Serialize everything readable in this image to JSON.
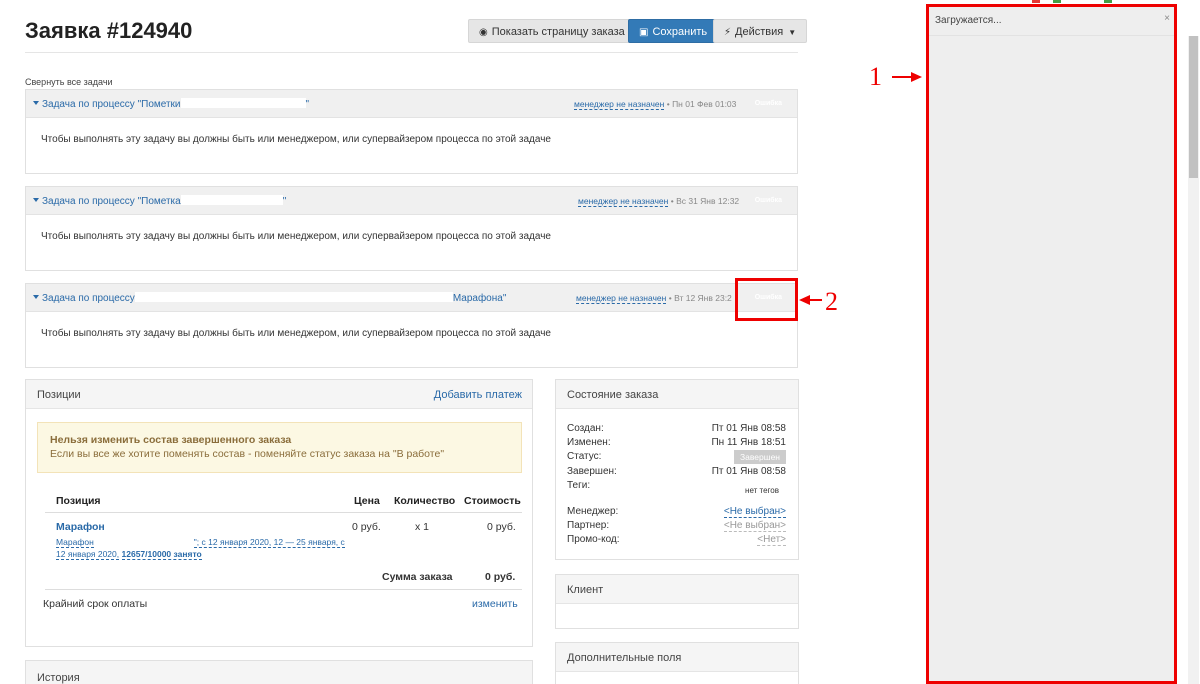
{
  "order": {
    "title": "Заявка #124940",
    "buttons": {
      "show_page": "Показать страницу заказа",
      "save": "Сохранить",
      "actions": "Действия"
    },
    "collapse_all": "Свернуть все задачи"
  },
  "tasks": [
    {
      "title_prefix": "Задача по процессу \"Пометки",
      "title_suffix": "\"",
      "manager": "менеджер не назначен",
      "date": "• Пн 01 Фев 01:03",
      "status": "Ошибка",
      "body": "Чтобы выполнять эту задачу вы должны быть или менеджером, или супервайзером процесса по этой задаче"
    },
    {
      "title_prefix": "Задача по процессу \"Пометка",
      "title_suffix": "\"",
      "manager": "менеджер не назначен",
      "date": "• Вс 31 Янв 12:32",
      "status": "Ошибка",
      "body": "Чтобы выполнять эту задачу вы должны быть или менеджером, или супервайзером процесса по этой задаче"
    },
    {
      "title_prefix": "Задача по процессу",
      "title_suffix": "Марафона\"",
      "manager": "менеджер не назначен",
      "date": "• Вт 12 Янв 23:2",
      "status": "Ошибка",
      "body": "Чтобы выполнять эту задачу вы должны быть или менеджером, или супервайзером процесса по этой задаче"
    }
  ],
  "positions": {
    "title": "Позиции",
    "add_payment": "Добавить платеж",
    "warning_title": "Нельзя изменить состав завершенного заказа",
    "warning_text": "Если вы все же хотите поменять состав - поменяйте статус заказа на \"В работе\"",
    "columns": [
      "Позиция",
      "Цена",
      "Количество",
      "Стоимость"
    ],
    "row": {
      "name": "Марафон",
      "desc_prefix": "Марафон",
      "desc_mid": "\"; с 12 января 2020, 12 — 25 января, с 12 января 2020,",
      "desc_bold": "12657/10000 занято",
      "price": "0 руб.",
      "qty": "x 1",
      "cost": "0 руб."
    },
    "total_label": "Сумма заказа",
    "total_value": "0 руб.",
    "deadline_label": "Крайний срок оплаты",
    "deadline_action": "изменить"
  },
  "history": {
    "title": "История"
  },
  "order_state": {
    "title": "Состояние заказа",
    "created_label": "Создан:",
    "created": "Пт 01 Янв 08:58",
    "changed_label": "Изменен:",
    "changed": "Пн 11 Янв 18:51",
    "status_label": "Статус:",
    "status": "Завершен",
    "finished_label": "Завершен:",
    "finished": "Пт 01 Янв 08:58",
    "tags_label": "Теги:",
    "tags": "нет тегов",
    "manager_label": "Менеджер:",
    "manager": "<Не выбран>",
    "partner_label": "Партнер:",
    "partner": "<Не выбран>",
    "promo_label": "Промо-код:",
    "promo": "<Нет>"
  },
  "client": {
    "title": "Клиент"
  },
  "extra_fields": {
    "title": "Дополнительные поля"
  },
  "side_panel": {
    "loading": "Загружается...",
    "close": "×"
  },
  "annotations": {
    "one": "1",
    "two": "2",
    "color": "#ee0000"
  }
}
